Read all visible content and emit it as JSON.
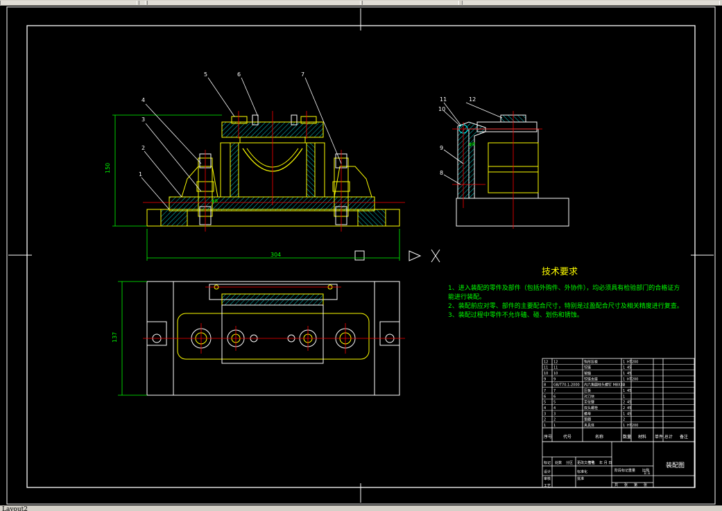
{
  "window": {
    "layout_tab": "Layout2"
  },
  "drawing": {
    "title_cn": "技术要求",
    "requirements": [
      "1、进入装配的零件及部件（包括外购件、外协件），均必须具有检验部门的合格证方能进行装配。",
      "2、装配前应对零、部件的主要配合尺寸，特别是过盈配合尺寸及相关精度进行复查。",
      "3、装配过程中零件不允许磕、碰、划伤和锈蚀。"
    ],
    "dimensions": {
      "overall_width": "304",
      "height_front": "150",
      "height_top": "137",
      "fit_phi": "φ8"
    },
    "balloons": [
      "1",
      "2",
      "3",
      "4",
      "5",
      "6",
      "7",
      "8",
      "9",
      "10",
      "11",
      "12"
    ],
    "bom_rows": [
      {
        "no": "12",
        "code": "12",
        "name": "钩形压板",
        "qty": "1",
        "mat": "HT200"
      },
      {
        "no": "11",
        "code": "11",
        "name": "铰链",
        "qty": "1",
        "mat": "45"
      },
      {
        "no": "10",
        "code": "10",
        "name": "销轴",
        "qty": "1",
        "mat": "45"
      },
      {
        "no": "9",
        "code": "9",
        "name": "铰链支座",
        "qty": "1",
        "mat": "HT200"
      },
      {
        "no": "8",
        "code": "GB/T70.1-2000",
        "name": "内六角圆柱头螺钉 M8X30",
        "qty": "2",
        "mat": ""
      },
      {
        "no": "7",
        "code": "7",
        "name": "压板",
        "qty": "1",
        "mat": "45"
      },
      {
        "no": "6",
        "code": "6",
        "name": "对刀块",
        "qty": "1",
        "mat": ""
      },
      {
        "no": "5",
        "code": "5",
        "name": "定位键",
        "qty": "2",
        "mat": "45"
      },
      {
        "no": "4",
        "code": "4",
        "name": "双头螺栓",
        "qty": "2",
        "mat": "45"
      },
      {
        "no": "3",
        "code": "3",
        "name": "螺母",
        "qty": "1",
        "mat": "45"
      },
      {
        "no": "2",
        "code": "2",
        "name": "垫圈",
        "qty": "2",
        "mat": ""
      },
      {
        "no": "1",
        "code": "1",
        "name": "夹具体",
        "qty": "1",
        "mat": "HT200"
      }
    ],
    "bom_header": [
      "序号",
      "代号",
      "名称",
      "数量",
      "材料",
      "单件 总计",
      "备注"
    ],
    "title_block": {
      "drawing_name": "装配图",
      "row_labels": [
        "标记",
        "处数",
        "分区",
        "更改文件号",
        "签名",
        "年 月 日"
      ],
      "left_labels": [
        "设计",
        "审核",
        "工艺"
      ],
      "mid_labels": [
        "标准化",
        "批准"
      ],
      "right_labels": [
        "阶段标记",
        "重量",
        "比例"
      ],
      "scale": "1:1",
      "sheet": [
        "共",
        "张",
        "第",
        "张"
      ]
    }
  },
  "colors": {
    "background": "#000000",
    "frame": "#ffffff",
    "part": "#ffff00",
    "centerline": "#ff0000",
    "dimension": "#00ff00",
    "hatch": "#00ffff",
    "text_req": "#00ff00",
    "title": "#ffff00"
  }
}
